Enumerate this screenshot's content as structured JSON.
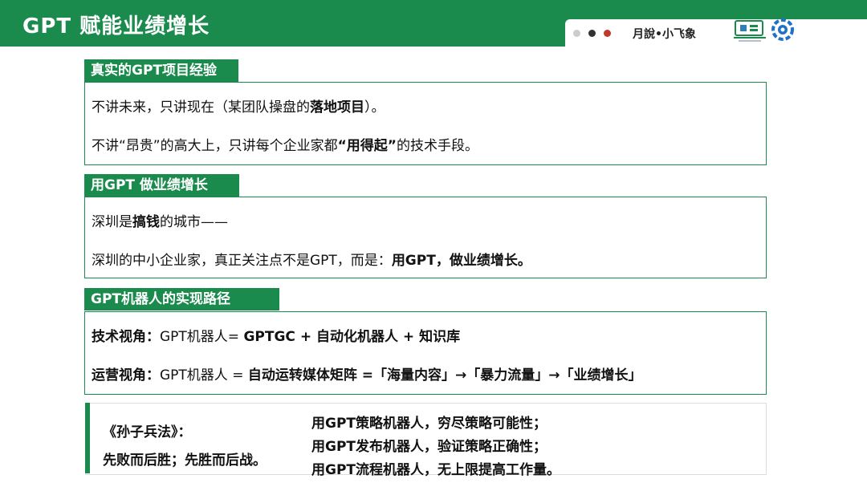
{
  "header": {
    "title": "GPT 赋能业绩增长",
    "brand": "月說•小飞象",
    "colors": {
      "green": "#1a8a4d",
      "dot1": "#cccccc",
      "dot2": "#333333",
      "dot3": "#c0392b"
    }
  },
  "sections": [
    {
      "title": "真实的GPT项目经验",
      "l1a": "不讲未来，只讲现在（某团队操盘的",
      "l1b": "落地项目",
      "l1c": "）。",
      "l2a": "不讲“昂贵”的高大上，只讲每个企业家都",
      "l2b": "“用得起”",
      "l2c": "的技术手段。"
    },
    {
      "title": "用GPT 做业绩增长",
      "l1a": "深圳是",
      "l1b": "搞钱",
      "l1c": "的城市——",
      "l2a": "深圳的中小企业家，真正关注点不是GPT，而是：",
      "l2b": "用GPT，做业绩增长。"
    },
    {
      "title": "GPT机器人的实现路径",
      "l1a": "技术视角：",
      "l1b": "GPT机器人= ",
      "l1c": "GPTGC + 自动化机器人 + 知识库",
      "l2a": "运营视角：",
      "l2b": "GPT机器人 = ",
      "l2c": "自动运转媒体矩阵 =「海量内容」→「暴力流量」→「业绩增长」"
    }
  ],
  "quote": {
    "source": "《孙子兵法》：",
    "saying": "先败而后胜；先胜而后战。",
    "items": [
      "用GPT策略机器人，穷尽策略可能性；",
      "用GPT发布机器人，验证策略正确性；",
      "用GPT流程机器人，无上限提高工作量。"
    ]
  }
}
